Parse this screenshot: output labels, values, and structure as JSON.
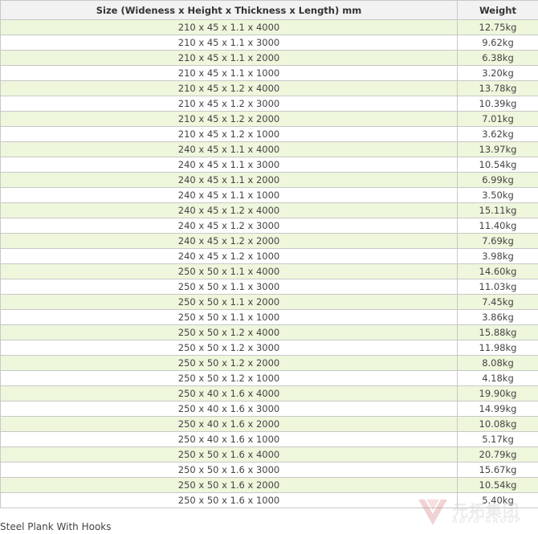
{
  "table": {
    "headers": {
      "size": "Size (Wideness x Height x Thickness x Length) mm",
      "weight": "Weight"
    },
    "rows": [
      {
        "size": "210 x 45 x 1.1 x 4000",
        "weight": "12.75kg"
      },
      {
        "size": "210 x 45 x 1.1 x 3000",
        "weight": "9.62kg"
      },
      {
        "size": "210 x 45 x 1.1 x 2000",
        "weight": "6.38kg"
      },
      {
        "size": "210 x 45 x 1.1 x 1000",
        "weight": "3.20kg"
      },
      {
        "size": "210 x 45 x 1.2 x 4000",
        "weight": "13.78kg"
      },
      {
        "size": "210 x 45 x 1.2 x 3000",
        "weight": "10.39kg"
      },
      {
        "size": "210 x 45 x 1.2 x 2000",
        "weight": "7.01kg"
      },
      {
        "size": "210 x 45 x 1.2 x 1000",
        "weight": "3.62kg"
      },
      {
        "size": "240 x 45 x 1.1 x 4000",
        "weight": "13.97kg"
      },
      {
        "size": "240 x 45 x 1.1 x 3000",
        "weight": "10.54kg"
      },
      {
        "size": "240 x 45 x 1.1 x 2000",
        "weight": "6.99kg"
      },
      {
        "size": "240 x 45 x 1.1 x 1000",
        "weight": "3.50kg"
      },
      {
        "size": "240 x 45 x 1.2 x 4000",
        "weight": "15.11kg"
      },
      {
        "size": "240 x 45 x 1.2 x 3000",
        "weight": "11.40kg"
      },
      {
        "size": "240 x 45 x 1.2 x 2000",
        "weight": "7.69kg"
      },
      {
        "size": "240 x 45 x 1.2 x 1000",
        "weight": "3.98kg"
      },
      {
        "size": "250 x 50 x 1.1 x 4000",
        "weight": "14.60kg"
      },
      {
        "size": "250 x 50 x 1.1 x 3000",
        "weight": "11.03kg"
      },
      {
        "size": "250 x 50 x 1.1 x 2000",
        "weight": "7.45kg"
      },
      {
        "size": "250 x 50 x 1.1 x 1000",
        "weight": "3.86kg"
      },
      {
        "size": "250 x 50 x 1.2 x 4000",
        "weight": "15.88kg"
      },
      {
        "size": "250 x 50 x 1.2 x 3000",
        "weight": "11.98kg"
      },
      {
        "size": "250 x 50 x 1.2 x 2000",
        "weight": "8.08kg"
      },
      {
        "size": "250 x 50 x 1.2 x 1000",
        "weight": "4.18kg"
      },
      {
        "size": "250 x 40 x 1.6 x 4000",
        "weight": "19.90kg"
      },
      {
        "size": "250 x 40 x 1.6 x 3000",
        "weight": "14.99kg"
      },
      {
        "size": "250 x 40 x 1.6 x 2000",
        "weight": "10.08kg"
      },
      {
        "size": "250 x 40 x 1.6 x 1000",
        "weight": "5.17kg"
      },
      {
        "size": "250 x 50 x 1.6 x 4000",
        "weight": "20.79kg"
      },
      {
        "size": "250 x 50 x 1.6 x 3000",
        "weight": "15.67kg"
      },
      {
        "size": "250 x 50 x 1.6 x 2000",
        "weight": "10.54kg"
      },
      {
        "size": "250 x 50 x 1.6 x 1000",
        "weight": "5.40kg"
      }
    ]
  },
  "caption": "Steel Plank With Hooks",
  "watermark": {
    "brand_cn": "元拓集团",
    "brand_en": "AOTO GROUP",
    "icon": "aoto-logo-icon"
  },
  "colors": {
    "row_alt": "#eef6dc",
    "header_bg": "#f2f2f2",
    "border": "#c8c8c8"
  }
}
